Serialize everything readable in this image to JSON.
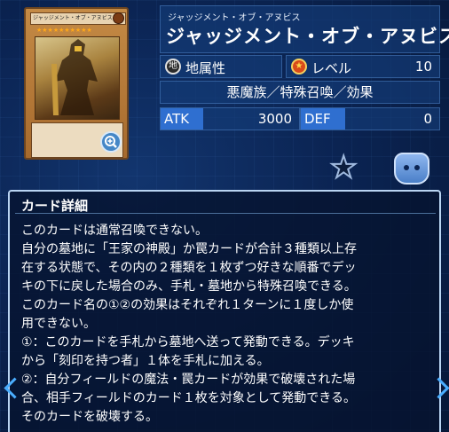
{
  "card": {
    "ruby": "ジャッジメント・オブ・アヌビス",
    "name": "ジャッジメント・オブ・アヌビス",
    "thumb_name": "ジャッジメント・オブ・アヌビス",
    "thumb_stars": "★★★★★★★★★★"
  },
  "attribute": {
    "icon": "earth-attribute-icon",
    "glyph": "地",
    "label": "地属性"
  },
  "level": {
    "icon": "level-star-icon",
    "label": "レベル",
    "value": "10"
  },
  "type_line": "悪魔族／特殊召喚／効果",
  "stats": {
    "atk_label": "ATK",
    "atk": "3000",
    "def_label": "DEF",
    "def": "0"
  },
  "icons": {
    "favorite": "star-outline-icon",
    "deck": "deck-character-icon",
    "zoom": "magnifier-plus-icon"
  },
  "details": {
    "title": "カード詳細",
    "lines": [
      "このカードは通常召喚できない。",
      "自分の墓地に「王家の神殿」か罠カードが合計３種類以上存",
      "在する状態で、その内の２種類を１枚ずつ好きな順番でデッ",
      "キの下に戻した場合のみ、手札・墓地から特殊召喚できる。",
      "このカード名の①②の効果はそれぞれ１ターンに１度しか使",
      "用できない。",
      "①：このカードを手札から墓地へ送って発動できる。デッキ",
      "から「刻印を持つ者」１体を手札に加える。",
      "②：自分フィールドの魔法・罠カードが効果で破壊された場",
      "合、相手フィールドのカード１枚を対象として発動できる。",
      "そのカードを破壊する。"
    ]
  },
  "colors": {
    "stat_tag": "#2f6fd0",
    "nav_arrow": "#4aaeff",
    "panel_border": "#b9d4f2"
  }
}
